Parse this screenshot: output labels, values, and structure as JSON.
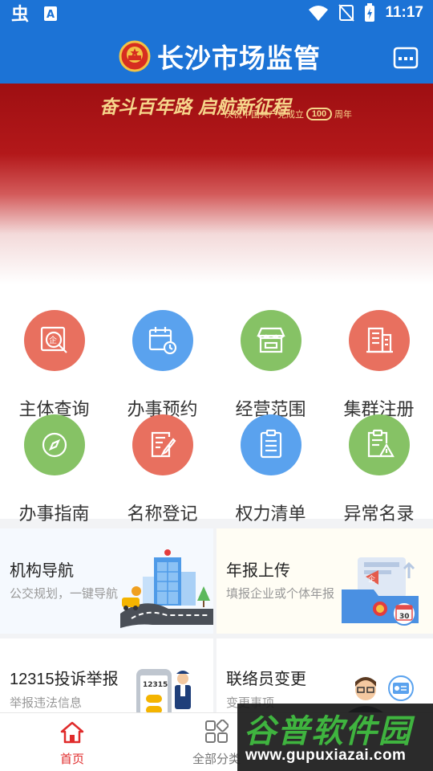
{
  "status_bar": {
    "time": "11:17"
  },
  "header": {
    "title": "长沙市场监管"
  },
  "banner": {
    "slogan": "奋斗百年路 启航新征程",
    "subtitle_prefix": "庆祝中国共产党成立",
    "subtitle_number": "100",
    "subtitle_suffix": "周年"
  },
  "services": [
    {
      "label": "主体查询",
      "color": "#e8705f",
      "icon": "enterprise-search-icon"
    },
    {
      "label": "办事预约",
      "color": "#5aa2ee",
      "icon": "calendar-clock-icon"
    },
    {
      "label": "经营范围",
      "color": "#86c265",
      "icon": "store-icon"
    },
    {
      "label": "集群注册",
      "color": "#e8705f",
      "icon": "building-icon"
    },
    {
      "label": "办事指南",
      "color": "#86c265",
      "icon": "compass-icon"
    },
    {
      "label": "名称登记",
      "color": "#e8705f",
      "icon": "edit-document-icon"
    },
    {
      "label": "权力清单",
      "color": "#5aa2ee",
      "icon": "list-document-icon"
    },
    {
      "label": "异常名录",
      "color": "#86c265",
      "icon": "warning-document-icon"
    }
  ],
  "cards": [
    {
      "title": "机构导航",
      "subtitle": "公交规划，一键导航"
    },
    {
      "title": "年报上传",
      "subtitle": "填报企业或个体年报"
    },
    {
      "title": "12315投诉举报",
      "subtitle": "举报违法信息",
      "phone_text": "12315"
    },
    {
      "title": "联络员变更",
      "subtitle": "变更事项"
    }
  ],
  "calendar_day": "30",
  "bottom_nav": [
    {
      "label": "首页",
      "active": true
    },
    {
      "label": "全部分类",
      "active": false
    }
  ],
  "watermark": {
    "brand": "谷普软件园",
    "url": "www.gupuxiazai.com"
  },
  "colors": {
    "primary": "#1c73d6",
    "active_nav": "#e02b2b"
  }
}
